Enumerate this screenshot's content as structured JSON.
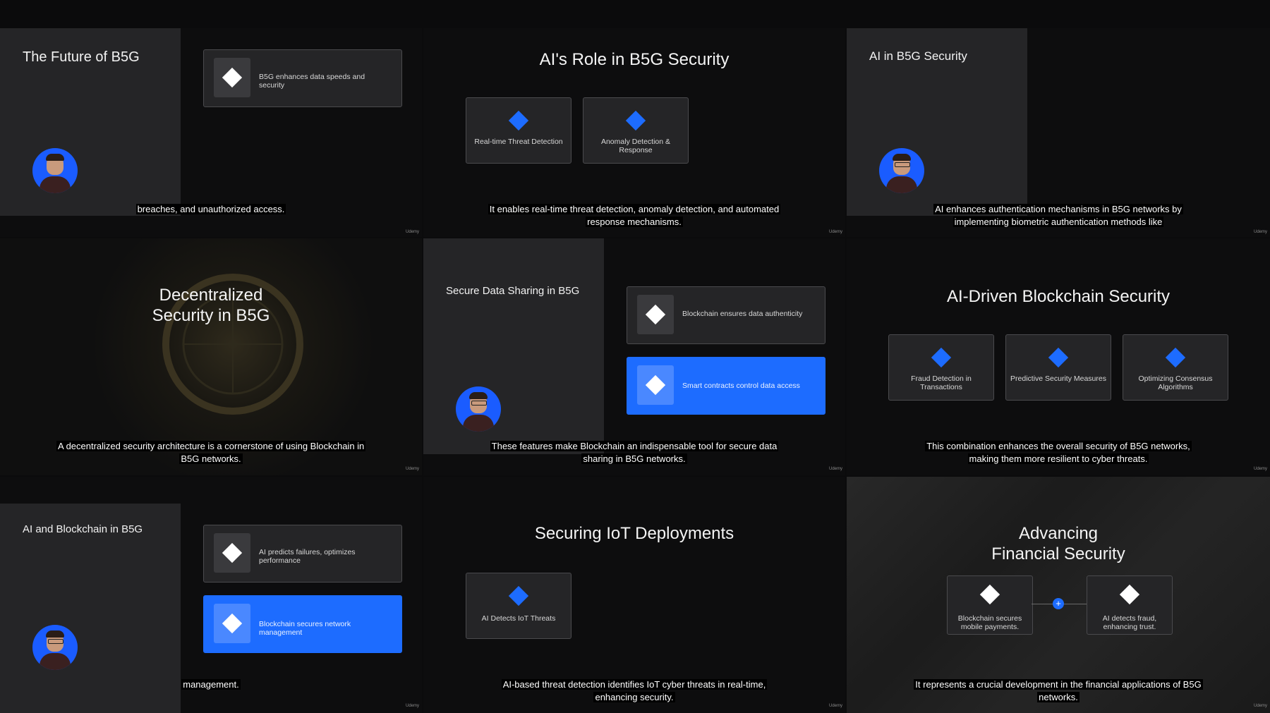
{
  "cells": {
    "c1": {
      "sidebar_title": "The Future of B5G",
      "card_text": "B5G enhances data speeds and security",
      "caption": "breaches, and unauthorized access.",
      "watermark": "Udemy"
    },
    "c2": {
      "title": "AI's Role in B5G Security",
      "cards": [
        "Real-time Threat Detection",
        "Anomaly Detection & Response"
      ],
      "caption": "It enables real-time threat detection, anomaly detection, and automated response mechanisms.",
      "watermark": "Udemy"
    },
    "c3": {
      "sidebar_title": "AI in B5G Security",
      "caption": "AI enhances authentication mechanisms in B5G networks by implementing biometric authentication methods like",
      "watermark": "Udemy"
    },
    "c4": {
      "title_line1": "Decentralized",
      "title_line2": "Security in B5G",
      "caption": "A decentralized security architecture is a cornerstone of using Blockchain in B5G networks.",
      "watermark": "Udemy"
    },
    "c5": {
      "sidebar_title": "Secure Data Sharing in B5G",
      "card1_text": "Blockchain ensures data authenticity",
      "card2_text": "Smart contracts control data access",
      "caption": "These features make Blockchain an indispensable tool for secure data sharing in B5G networks.",
      "watermark": "Udemy"
    },
    "c6": {
      "title": "AI-Driven Blockchain Security",
      "cards": [
        "Fraud Detection in Transactions",
        "Predictive Security Measures",
        "Optimizing Consensus Algorithms"
      ],
      "caption": "This combination enhances the overall security of B5G networks, making them more resilient to cyber threats.",
      "watermark": "Udemy"
    },
    "c7": {
      "sidebar_title": "AI and Blockchain in B5G",
      "card1_text": "AI predicts failures, optimizes performance",
      "card2_text": "Blockchain secures network management",
      "caption": "management.",
      "watermark": "Udemy"
    },
    "c8": {
      "title": "Securing IoT Deployments",
      "cards": [
        "AI Detects IoT Threats"
      ],
      "caption": "AI-based threat detection identifies IoT cyber threats in real-time, enhancing security.",
      "watermark": "Udemy"
    },
    "c9": {
      "title_line1": "Advancing",
      "title_line2": "Financial Security",
      "card1_text": "Blockchain secures mobile payments.",
      "card2_text": "AI detects fraud, enhancing trust.",
      "plus": "+",
      "caption": "It represents a crucial development in the financial applications of B5G networks.",
      "watermark": "Udemy"
    }
  },
  "colors": {
    "accent_blue": "#1d6cff",
    "sidebar_gray": "#252527",
    "background": "#0d0d0e"
  }
}
